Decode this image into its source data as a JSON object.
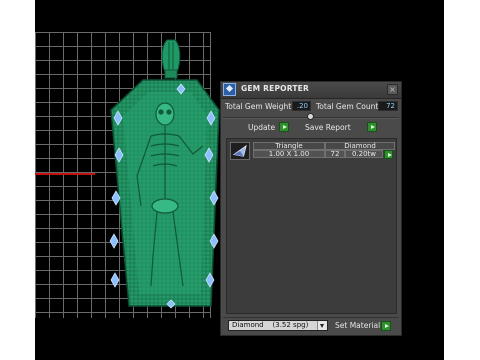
{
  "panel": {
    "title": "GEM REPORTER",
    "close_glyph": "×",
    "total_gem_weight_label": "Total Gem Weight",
    "total_gem_weight_value": ".20",
    "total_gem_count_label": "Total Gem Count",
    "total_gem_count_value": "72",
    "update_label": "Update",
    "save_report_label": "Save Report",
    "gems": [
      {
        "cut": "Triangle",
        "material": "Diamond",
        "size": "1.00 X 1.00",
        "count": "72",
        "weight": "0.20tw"
      }
    ],
    "material_select": {
      "selected": "Diamond    (3.52 spg)"
    },
    "set_material_label": "Set Material"
  },
  "icons": {
    "app": "gem-reporter-app-icon",
    "close": "close-icon",
    "go": "green-arrow-icon",
    "thumb": "triangle-gem-icon",
    "dropdown": "chevron-down-icon"
  },
  "colors": {
    "model_green": "#1f8a5c",
    "gem_blue": "#7fb0ff",
    "panel_bg": "#4a4a4a",
    "go_green": "#2f8f2f"
  }
}
